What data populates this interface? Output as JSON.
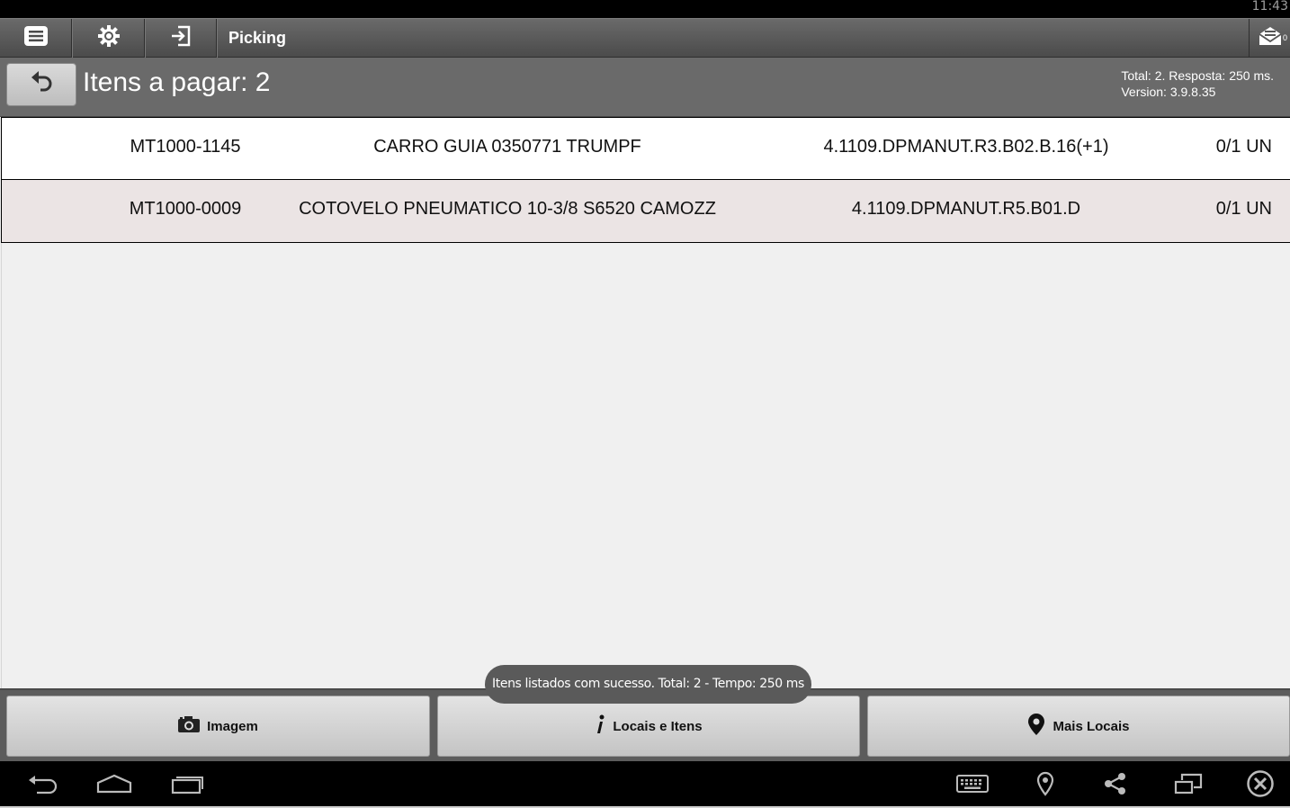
{
  "status_bar": {
    "time": "11:43"
  },
  "action_bar": {
    "title": "Picking",
    "menu_icon": "menu-icon",
    "settings_icon": "gear-icon",
    "login_icon": "sign-in-icon",
    "mail_icon": "mail-icon",
    "mail_count": "0"
  },
  "header": {
    "back_icon": "undo-arrow-icon",
    "title": "Itens a pagar: 2",
    "info_line1": "Total: 2. Resposta: 250 ms.",
    "info_line2": "Version: 3.9.8.35"
  },
  "items": [
    {
      "code": "MT1000-1145",
      "description": "CARRO GUIA 0350771 TRUMPF",
      "location": "4.1109.DPMANUT.R3.B02.B.16(+1)",
      "quantity": "0/1 UN"
    },
    {
      "code": "MT1000-0009",
      "description": "COTOVELO PNEUMATICO 10-3/8 S6520 CAMOZZ",
      "location": "4.1109.DPMANUT.R5.B01.D",
      "quantity": "0/1 UN"
    }
  ],
  "toast": {
    "message": "Itens listados com sucesso. Total: 2 - Tempo: 250 ms"
  },
  "bottom_buttons": {
    "image": {
      "label": "Imagem",
      "icon": "camera-icon"
    },
    "locations_items": {
      "label": "Locais e Itens",
      "icon": "info-icon"
    },
    "more_locations": {
      "label": "Mais Locais",
      "icon": "map-pin-icon"
    }
  },
  "nav_bar": {
    "icons": [
      "back-icon",
      "home-icon",
      "recent-apps-icon",
      "keyboard-icon",
      "location-icon",
      "share-icon",
      "window-icon",
      "close-circle-icon"
    ]
  },
  "colors": {
    "action_bar": "#595959",
    "header_band": "#6a6a6a",
    "row_alt": "#ebe4e4",
    "toast": "#5a5a5a"
  }
}
